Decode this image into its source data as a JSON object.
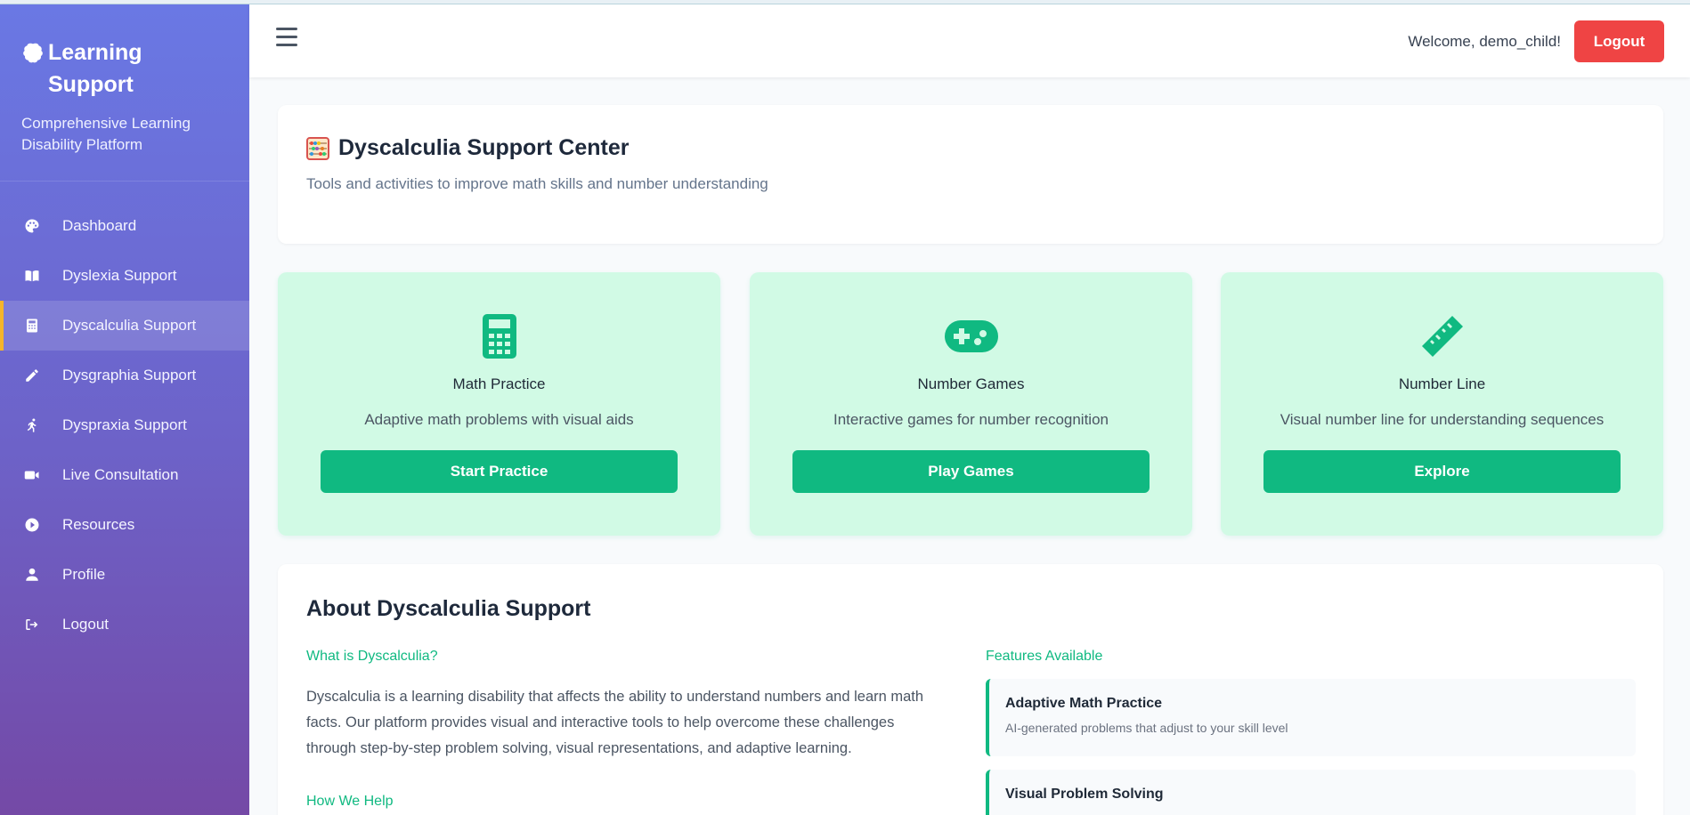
{
  "brand": {
    "title": "Learning Support",
    "subtitle": "Comprehensive Learning Disability Platform",
    "icon": "brain-icon"
  },
  "sidebar": {
    "items": [
      {
        "label": "Dashboard",
        "icon": "palette-icon"
      },
      {
        "label": "Dyslexia Support",
        "icon": "book-icon"
      },
      {
        "label": "Dyscalculia Support",
        "icon": "calculator-icon",
        "active": true
      },
      {
        "label": "Dysgraphia Support",
        "icon": "pencil-icon"
      },
      {
        "label": "Dyspraxia Support",
        "icon": "running-icon"
      },
      {
        "label": "Live Consultation",
        "icon": "video-icon"
      },
      {
        "label": "Resources",
        "icon": "play-circle-icon"
      },
      {
        "label": "Profile",
        "icon": "user-icon"
      },
      {
        "label": "Logout",
        "icon": "sign-out-icon"
      }
    ],
    "active_accent": "#f5b52a"
  },
  "header": {
    "welcome": "Welcome, demo_child!",
    "logout_label": "Logout"
  },
  "hero": {
    "title": "Dyscalculia Support Center",
    "subtitle": "Tools and activities to improve math skills and number understanding",
    "icon": "abacus-icon"
  },
  "tools": [
    {
      "title": "Math Practice",
      "description": "Adaptive math problems with visual aids",
      "button": "Start Practice",
      "icon": "calculator-icon"
    },
    {
      "title": "Number Games",
      "description": "Interactive games for number recognition",
      "button": "Play Games",
      "icon": "gamepad-icon"
    },
    {
      "title": "Number Line",
      "description": "Visual number line for understanding sequences",
      "button": "Explore",
      "icon": "ruler-icon"
    }
  ],
  "about": {
    "title": "About Dyscalculia Support",
    "what_heading": "What is Dyscalculia?",
    "what_text": "Dyscalculia is a learning disability that affects the ability to understand numbers and learn math facts. Our platform provides visual and interactive tools to help overcome these challenges through step-by-step problem solving, visual representations, and adaptive learning.",
    "how_heading": "How We Help",
    "features_heading": "Features Available",
    "features": [
      {
        "title": "Adaptive Math Practice",
        "description": "AI-generated problems that adjust to your skill level"
      },
      {
        "title": "Visual Problem Solving",
        "description": ""
      }
    ]
  },
  "colors": {
    "primary_green": "#10b981",
    "tool_bg": "#d1fae5",
    "logout_red": "#ef4444",
    "sidebar_gradient_top": "#6a78e4",
    "sidebar_gradient_bottom": "#7449a6"
  }
}
